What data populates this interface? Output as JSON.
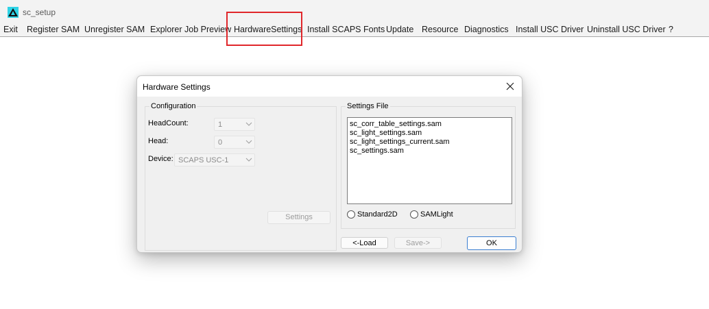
{
  "window": {
    "title": "sc_setup"
  },
  "menu": [
    "Exit",
    "Register SAM",
    "Unregister SAM",
    "Explorer Job Preview",
    "HardwareSettings",
    "Install SCAPS Fonts",
    "Update",
    "Resource",
    "Diagnostics",
    "Install USC Driver",
    "Uninstall USC Driver",
    "?"
  ],
  "highlight": {
    "color": "#e0262a"
  },
  "dialog": {
    "title": "Hardware Settings",
    "configuration": {
      "legend": "Configuration",
      "headcount_label": "HeadCount:",
      "headcount_value": "1",
      "head_label": "Head:",
      "head_value": "0",
      "device_label": "Device:",
      "device_value": "SCAPS USC-1",
      "settings_button": "Settings"
    },
    "settings_file": {
      "legend": "Settings File",
      "files": [
        "sc_corr_table_settings.sam",
        "sc_light_settings.sam",
        "sc_light_settings_current.sam",
        "sc_settings.sam"
      ],
      "radio_standard": "Standard2D",
      "radio_samlight": "SAMLight"
    },
    "buttons": {
      "load": "<-Load",
      "save": "Save->",
      "ok": "OK"
    }
  }
}
